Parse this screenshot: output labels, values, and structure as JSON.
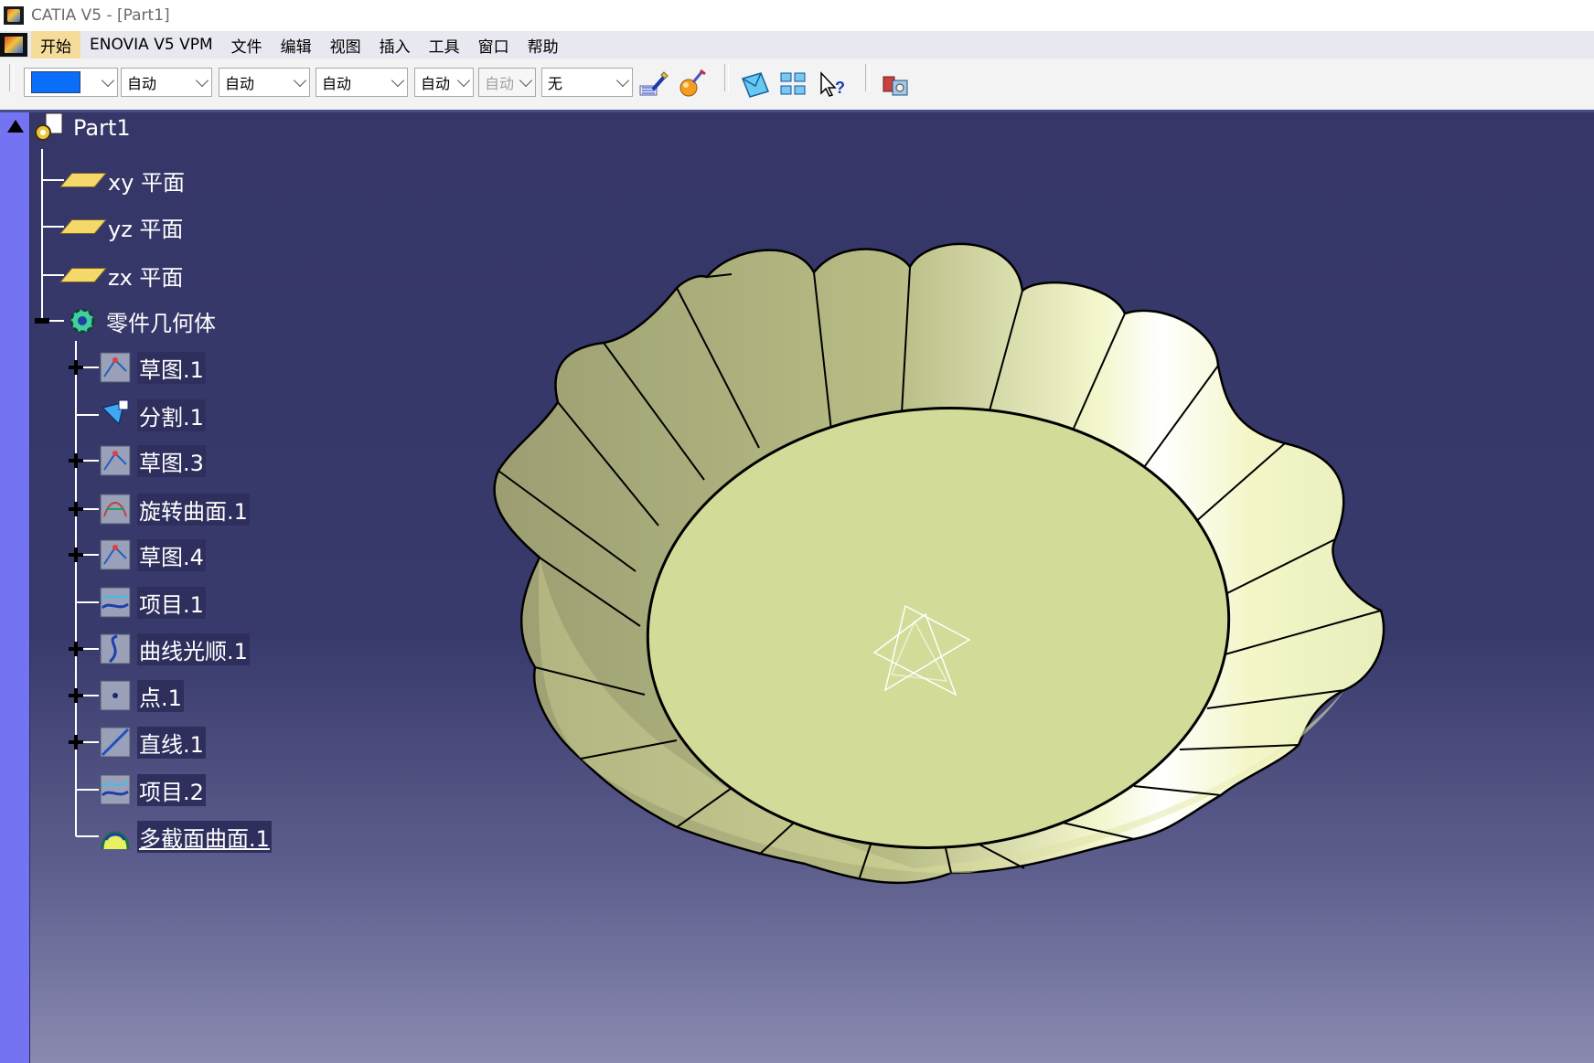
{
  "window": {
    "title": "CATIA V5 - [Part1]"
  },
  "menubar": {
    "items": [
      {
        "label": "开始",
        "active": true
      },
      {
        "label": "ENOVIA V5 VPM"
      },
      {
        "label": "文件"
      },
      {
        "label": "编辑"
      },
      {
        "label": "视图"
      },
      {
        "label": "插入"
      },
      {
        "label": "工具"
      },
      {
        "label": "窗口"
      },
      {
        "label": "帮助"
      }
    ]
  },
  "toolbar": {
    "color_swatch": "#0a6ef8",
    "combo_transparency": "自动",
    "combo_linetype": "自动",
    "combo_thickness": "自动",
    "combo_point": "自动",
    "combo_disabled": "自动",
    "combo_layer": "无",
    "icons": [
      "painter-icon",
      "ball-paint-icon",
      "sketch-envelope-icon",
      "frames-icon",
      "whats-this-icon",
      "catalog-icon"
    ]
  },
  "tree": {
    "root": "Part1",
    "planes": [
      "xy 平面",
      "yz 平面",
      "zx 平面"
    ],
    "body": "零件几何体",
    "features": [
      {
        "label": "草图.1",
        "icon": "sketch-icon",
        "expandable": true
      },
      {
        "label": "分割.1",
        "icon": "split-icon",
        "expandable": false
      },
      {
        "label": "草图.3",
        "icon": "sketch-icon",
        "expandable": true
      },
      {
        "label": "旋转曲面.1",
        "icon": "revolve-surface-icon",
        "expandable": true
      },
      {
        "label": "草图.4",
        "icon": "sketch-icon",
        "expandable": true
      },
      {
        "label": "项目.1",
        "icon": "projection-icon",
        "expandable": false
      },
      {
        "label": "曲线光顺.1",
        "icon": "curve-smooth-icon",
        "expandable": true
      },
      {
        "label": "点.1",
        "icon": "point-icon",
        "expandable": true
      },
      {
        "label": "直线.1",
        "icon": "line-icon",
        "expandable": true
      },
      {
        "label": "项目.2",
        "icon": "projection-icon",
        "expandable": false
      },
      {
        "label": "多截面曲面.1",
        "icon": "multi-section-surface-icon",
        "expandable": false,
        "current": true
      }
    ]
  },
  "colors": {
    "background_top": "#363668",
    "background_bottom": "#8a8ab0",
    "left_strip": "#7474f2",
    "surface": "#d4dc98",
    "surface_dark": "#9ea070",
    "highlight": "#ffffff"
  }
}
